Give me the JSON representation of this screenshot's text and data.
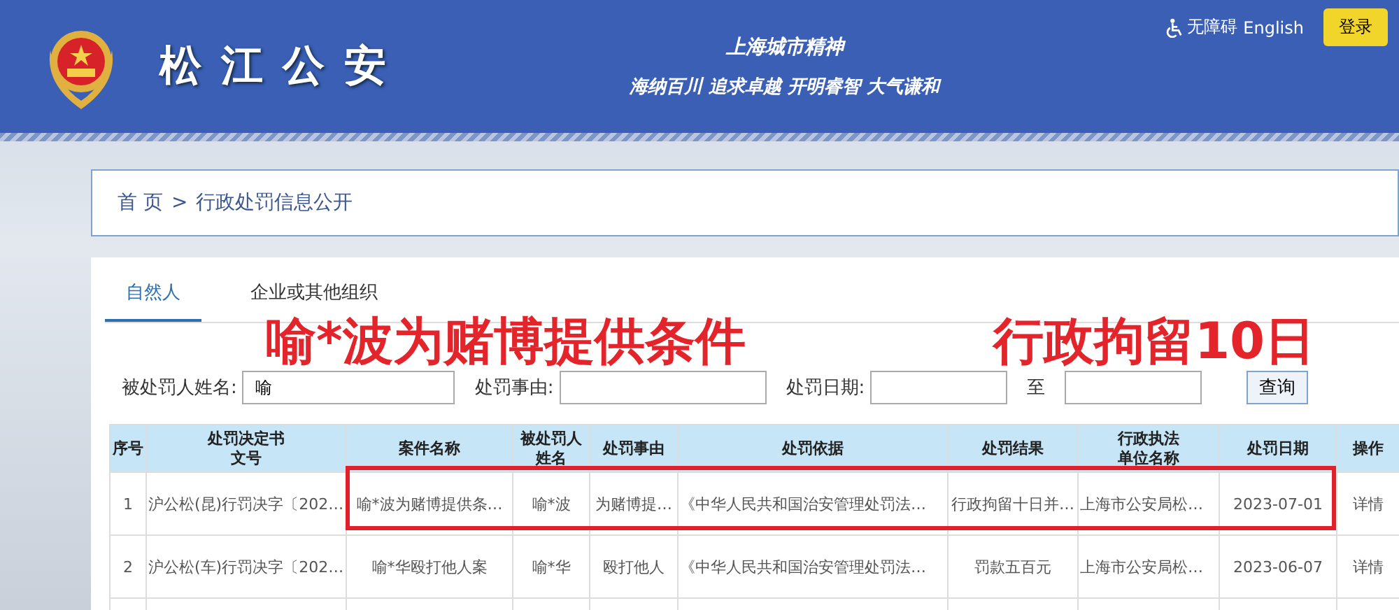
{
  "header": {
    "site_title": "松江公安",
    "slogan_title": "上海城市精神",
    "slogan": "海纳百川 追求卓越 开明睿智 大气谦和",
    "accessibility_link": "无障碍",
    "language_link": "English",
    "login_button": "登录"
  },
  "breadcrumb": [
    {
      "label": "首 页"
    },
    {
      "label": "行政处罚信息公开"
    }
  ],
  "breadcrumb_separator": ">",
  "tabs": [
    {
      "label": "自然人",
      "selected": true
    },
    {
      "label": "企业或其他组织",
      "selected": false
    }
  ],
  "overlay_captions": [
    "喻*波为赌博提供条件",
    "行政拘留10日"
  ],
  "search": {
    "fields": [
      {
        "label": "被处罚人姓名:",
        "value": "喻"
      },
      {
        "label": "处罚事由:"
      },
      {
        "label": "处罚日期:"
      },
      {
        "label": "至"
      }
    ],
    "button": "查询"
  },
  "table": {
    "columns": [
      "序号",
      "处罚决定书文号",
      "案件名称",
      "被处罚人姓名",
      "处罚事由",
      "处罚依据",
      "处罚结果",
      "行政执法单位名称",
      "处罚日期",
      "操作"
    ],
    "rows": [
      {
        "highlighted": true,
        "cells": [
          "1",
          "沪公松(昆)行罚决字〔202…",
          "喻*波为赌博提供条…",
          "喻*波",
          "为赌博提…",
          "《中华人民共和国治安管理处罚法…",
          "行政拘留十日并…",
          "上海市公安局松…",
          "2023-07-01",
          "详情"
        ]
      },
      {
        "highlighted": false,
        "cells": [
          "2",
          "沪公松(车)行罚决字〔202…",
          "喻*华殴打他人案",
          "喻*华",
          "殴打他人",
          "《中华人民共和国治安管理处罚法…",
          "罚款五百元",
          "上海市公安局松…",
          "2023-06-07",
          "详情"
        ]
      }
    ]
  }
}
